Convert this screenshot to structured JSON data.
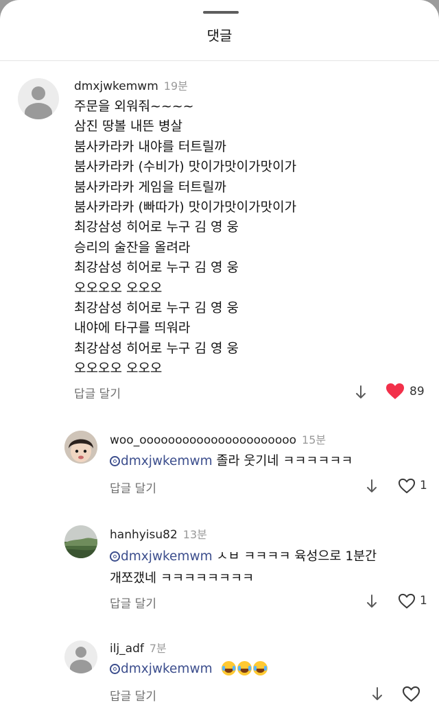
{
  "sheet": {
    "title": "댓글"
  },
  "comments": [
    {
      "username": "dmxjwkemwm",
      "time": "19분",
      "lines": [
        "주문을 외워줘~~~~",
        "삼진 땅볼 내뜬 병살",
        "붐사카라카 내야를 터트릴까",
        "붐사카라카 (수비가) 맛이가맛이가맛이가",
        "붐사카라카 게임을 터트릴까",
        "붐사카라카 (빠따가) 맛이가맛이가맛이가",
        "최강삼성 히어로 누구 김 영 웅",
        "승리의 술잔을 올려라",
        "최강삼성 히어로 누구 김 영 웅",
        "오오오오 오오오",
        "최강삼성 히어로 누구 김 영 웅",
        "내야에 타구를 띄워라",
        "최강삼성 히어로 누구 김 영 웅",
        "오오오오 오오오"
      ],
      "reply_label": "답글 달기",
      "likes": "89",
      "liked": true,
      "avatar": "default-avatar",
      "heart_color": "#f2304a"
    }
  ],
  "replies": [
    {
      "username": "woo_oooooooooooooooooooooo",
      "time": "15분",
      "mention": "dmxjwkemwm",
      "text": " 졸라 웃기네 ㅋㅋㅋㅋㅋㅋ",
      "reply_label": "답글 달기",
      "likes": "1",
      "avatar": "child-photo-avatar"
    },
    {
      "username": "hanhyisu82",
      "time": "13분",
      "mention": "dmxjwkemwm",
      "text": " ㅅㅂ ㅋㅋㅋㅋ 육성으로 1분간",
      "text_line2": "개쪼갰네 ㅋㅋㅋㅋㅋㅋㅋㅋ",
      "reply_label": "답글 달기",
      "likes": "1",
      "avatar": "landscape-photo-avatar"
    },
    {
      "username": "ilj_adf",
      "time": "7분",
      "mention": "dmxjwkemwm",
      "text": "",
      "emojis": [
        "laughing-tears-emoji",
        "laughing-tears-emoji",
        "laughing-tears-emoji"
      ],
      "reply_label": "답글 달기",
      "likes": "",
      "avatar": "default-avatar"
    }
  ],
  "colors": {
    "mention": "#3b4d8c",
    "liked_heart": "#f2304a",
    "secondary_text": "#6f6f6f",
    "backdrop": "#9b9b9b"
  }
}
